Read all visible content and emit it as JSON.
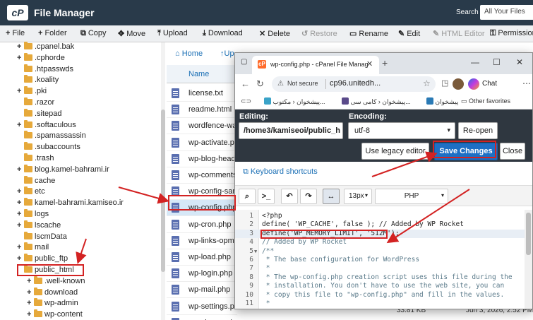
{
  "header": {
    "logo_text": "cP",
    "title": "File Manager",
    "search_label": "Search",
    "search_value": "All Your Files"
  },
  "toolbar": {
    "file": "File",
    "folder": "Folder",
    "copy": "Copy",
    "move": "Move",
    "upload": "Upload",
    "download": "Download",
    "delete": "Delete",
    "restore": "Restore",
    "rename": "Rename",
    "edit": "Edit",
    "html_editor": "HTML Editor",
    "permissions": "Permissions"
  },
  "tree": {
    "items": [
      {
        "label": ".cpanel.bak",
        "plus": true
      },
      {
        "label": ".cphorde",
        "plus": true
      },
      {
        "label": ".htpasswds",
        "plus": false
      },
      {
        "label": ".koality",
        "plus": false
      },
      {
        "label": ".pki",
        "plus": true
      },
      {
        "label": ".razor",
        "plus": false
      },
      {
        "label": ".sitepad",
        "plus": false
      },
      {
        "label": ".softaculous",
        "plus": true
      },
      {
        "label": ".spamassassin",
        "plus": false
      },
      {
        "label": ".subaccounts",
        "plus": false
      },
      {
        "label": ".trash",
        "plus": false
      },
      {
        "label": "blog.kamel-bahrami.ir",
        "plus": true
      },
      {
        "label": "cache",
        "plus": false
      },
      {
        "label": "etc",
        "plus": true
      },
      {
        "label": "kamel-bahrami.kamiseo.ir",
        "plus": true
      },
      {
        "label": "logs",
        "plus": true
      },
      {
        "label": "lscache",
        "plus": true
      },
      {
        "label": "lscmData",
        "plus": false
      },
      {
        "label": "mail",
        "plus": true
      },
      {
        "label": "public_ftp",
        "plus": true
      },
      {
        "label": "public_html",
        "plus": false
      },
      {
        "label": ".well-known",
        "plus": true
      },
      {
        "label": "download",
        "plus": true
      },
      {
        "label": "wp-admin",
        "plus": true
      },
      {
        "label": "wp-content",
        "plus": true
      }
    ]
  },
  "filelist": {
    "home": "Home",
    "up": "Up",
    "name_header": "Name",
    "files": [
      "license.txt",
      "readme.html",
      "wordfence-waf",
      "wp-activate.php",
      "wp-blog-header",
      "wp-comments-",
      "wp-config-sam",
      "wp-config.php",
      "wp-cron.php",
      "wp-links-opml.",
      "wp-load.php",
      "wp-login.php",
      "wp-mail.php",
      "wp-settings.ph",
      "wp-signup.php"
    ],
    "size": "33.81 KB",
    "date": "Jun 3, 2026, 2:52 PM"
  },
  "browser": {
    "tab_title": "wp-config.php - cPanel File Manag",
    "not_secure": "Not secure",
    "url": "cp96.unitedh...",
    "chat": "Chat",
    "bookmark_1": "پیشخوان ‹ مکتوب...",
    "bookmark_2": "پیشخوان ‹ کامی سی...",
    "bookmark_3": "پیشخوان",
    "other_bookmarks": "Other favorites"
  },
  "editor": {
    "editing_label": "Editing:",
    "path": "/home3/kamiseoi/public_h",
    "encoding_label": "Encoding:",
    "encoding": "utf-8",
    "reopen": "Re-open",
    "legacy": "Use legacy editor",
    "save": "Save Changes",
    "close": "Close",
    "shortcuts": "Keyboard shortcuts",
    "font_size": "13px",
    "mode": "PHP",
    "lines": [
      {
        "n": "1",
        "text": "<?php"
      },
      {
        "n": "2",
        "text": "define( 'WP_CACHE', false ); // Added by WP Rocket"
      },
      {
        "n": "3",
        "text": "define('WP_MEMORY_LIMIT', '512M');"
      },
      {
        "n": "4",
        "text": "// Added by WP Rocket"
      },
      {
        "n": "5",
        "text": "/**"
      },
      {
        "n": "6",
        "text": " * The base configuration for WordPress"
      },
      {
        "n": "7",
        "text": " *"
      },
      {
        "n": "8",
        "text": " * The wp-config.php creation script uses this file during the"
      },
      {
        "n": "9",
        "text": " * installation. You don't have to use the web site, you can"
      },
      {
        "n": "10",
        "text": " * copy this file to \"wp-config.php\" and fill in the values."
      },
      {
        "n": "11",
        "text": " *"
      }
    ]
  }
}
